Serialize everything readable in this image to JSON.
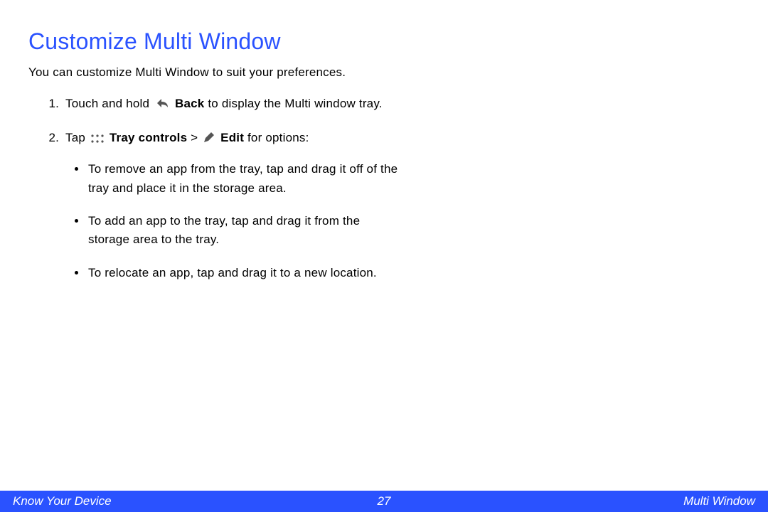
{
  "title": "Customize Multi Window",
  "intro": "You can customize Multi Window to suit your preferences.",
  "steps": {
    "s1": {
      "pre": "Touch and hold ",
      "bold1": "Back",
      "post": " to display the Multi window tray."
    },
    "s2": {
      "pre": "Tap ",
      "bold1": "Tray controls",
      "sep": " > ",
      "bold2": "Edit",
      "post": " for options:"
    }
  },
  "bullets": {
    "b1": "To remove an app from the tray, tap and drag it off of the tray and place it in the storage area.",
    "b2": "To add an app to the tray, tap and drag it from the storage area to the tray.",
    "b3": "To relocate an app, tap and drag it to a new location."
  },
  "footer": {
    "left": "Know Your Device",
    "page": "27",
    "right": "Multi Window"
  }
}
